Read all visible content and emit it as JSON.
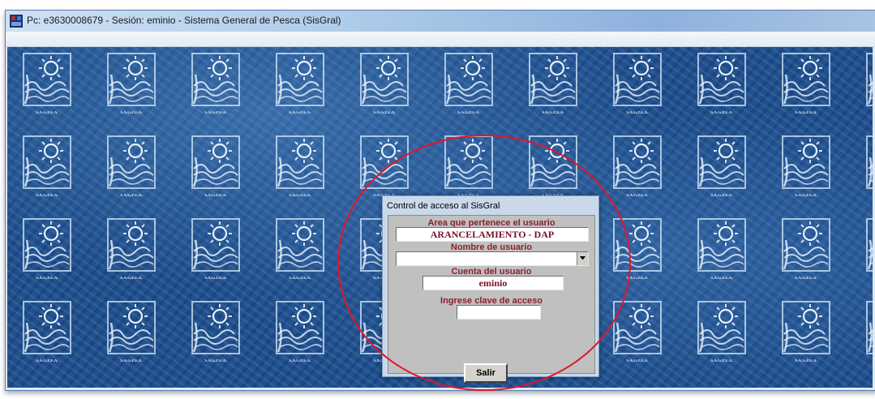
{
  "window": {
    "title": "Pc: e3630008679 - Sesión: eminio - Sistema General de Pesca (SisGral)"
  },
  "desktop": {
    "tile_label": "S.A.G.P.E.A."
  },
  "dialog": {
    "title": "Control de acceso al SisGral",
    "area_label": "Area que pertenece el usuario",
    "area_value": "ARANCELAMIENTO - DAP",
    "username_label": "Nombre de usuario",
    "username_value": "",
    "account_label": "Cuenta del usuario",
    "account_value": "eminio",
    "password_label": "Ingrese clave de acceso",
    "password_value": "",
    "exit_button": "Salir"
  },
  "colors": {
    "label_text": "#8c1f2b",
    "value_text": "#7a1030",
    "annotation_circle": "#e0162b",
    "desktop_blue": "#1e4f8f"
  }
}
